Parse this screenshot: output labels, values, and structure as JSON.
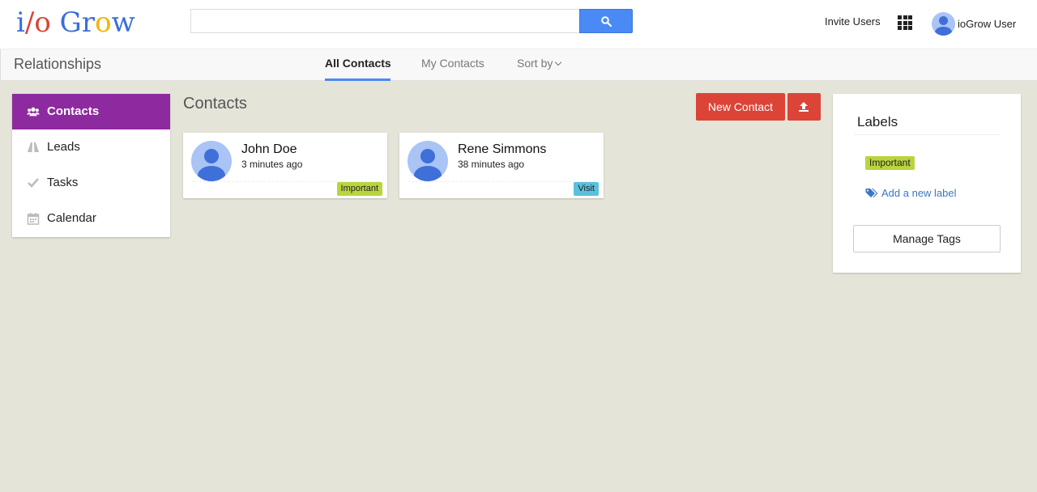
{
  "logo": {
    "parts": [
      {
        "text": "i",
        "color": "#3a6fd8"
      },
      {
        "text": "/",
        "color": "#db4437"
      },
      {
        "text": "o",
        "color": "#db4437"
      },
      {
        "text": " ",
        "color": "#000000"
      },
      {
        "text": "G",
        "color": "#3a6fd8"
      },
      {
        "text": "r",
        "color": "#3a6fd8"
      },
      {
        "text": "o",
        "color": "#f4b400"
      },
      {
        "text": "w",
        "color": "#3a6fd8"
      }
    ]
  },
  "search": {
    "value": "",
    "placeholder": "",
    "button_icon": "search-icon",
    "button_color": "#4a8af4"
  },
  "header": {
    "invite_label": "Invite Users",
    "apps_icon": "apps-grid-icon",
    "user_name": "ioGrow User"
  },
  "subnav": {
    "section_title": "Relationships",
    "tabs": [
      {
        "label": "All Contacts",
        "active": true
      },
      {
        "label": "My Contacts",
        "active": false
      },
      {
        "label": "Sort by",
        "active": false,
        "dropdown": true
      }
    ]
  },
  "sidebar": {
    "accent": "#8e2a9f",
    "items": [
      {
        "label": "Contacts",
        "icon": "users-icon",
        "active": true
      },
      {
        "label": "Leads",
        "icon": "road-icon",
        "active": false
      },
      {
        "label": "Tasks",
        "icon": "check-icon",
        "active": false
      },
      {
        "label": "Calendar",
        "icon": "calendar-icon",
        "active": false
      }
    ]
  },
  "main": {
    "title": "Contacts",
    "new_contact_label": "New Contact",
    "upload_icon": "upload-icon",
    "button_color": "#db4437",
    "contacts": [
      {
        "name": "John Doe",
        "time": "3 minutes ago",
        "tag": "Important",
        "tag_color": "#b9d43f"
      },
      {
        "name": "Rene Simmons",
        "time": "38 minutes ago",
        "tag": "Visit",
        "tag_color": "#5bc0de"
      }
    ]
  },
  "labels": {
    "title": "Labels",
    "items": [
      {
        "label": "Important",
        "color": "#b9d43f"
      }
    ],
    "add_label": "Add a new label",
    "manage_label": "Manage Tags"
  }
}
